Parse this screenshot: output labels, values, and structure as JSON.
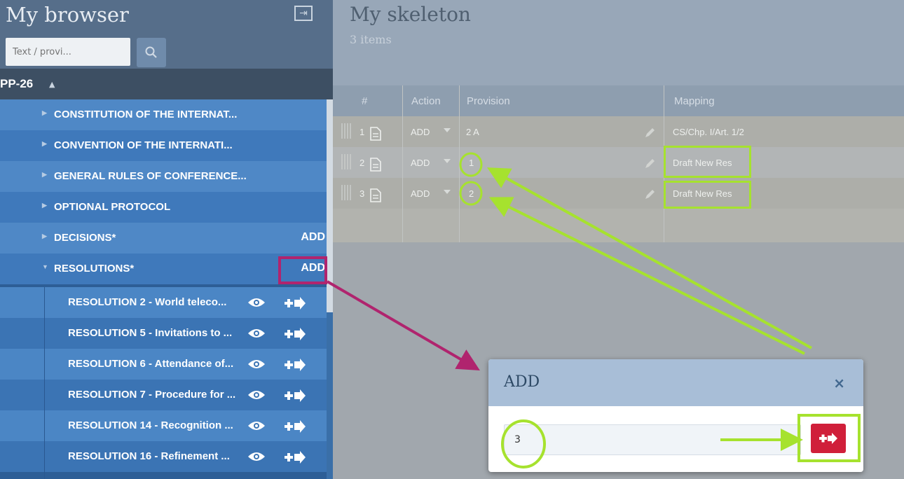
{
  "sidebar": {
    "title": "My browser",
    "search_placeholder": "Text / provi...",
    "pp_label": "PP-26",
    "items": [
      {
        "label": "CONSTITUTION OF THE INTERNAT...",
        "add": ""
      },
      {
        "label": "CONVENTION OF THE INTERNATI...",
        "add": ""
      },
      {
        "label": "GENERAL RULES OF CONFERENCE...",
        "add": ""
      },
      {
        "label": "OPTIONAL PROTOCOL",
        "add": ""
      },
      {
        "label": "DECISIONS*",
        "add": "ADD"
      },
      {
        "label": "RESOLUTIONS*",
        "add": "ADD"
      }
    ],
    "sub_items": [
      {
        "label": "RESOLUTION 2 - World teleco..."
      },
      {
        "label": "RESOLUTION 5 - Invitations to ..."
      },
      {
        "label": "RESOLUTION 6 - Attendance of..."
      },
      {
        "label": "RESOLUTION 7 - Procedure for ..."
      },
      {
        "label": "RESOLUTION 14 - Recognition ..."
      },
      {
        "label": "RESOLUTION 16 - Refinement ..."
      }
    ]
  },
  "main": {
    "title": "My skeleton",
    "subtitle": "3 items",
    "columns": [
      "#",
      "Action",
      "Provision",
      "Mapping"
    ],
    "rows": [
      {
        "num": "1",
        "action": "ADD",
        "provision": "2 A",
        "mapping": "CS/Chp. I/Art. 1/2"
      },
      {
        "num": "2",
        "action": "ADD",
        "provision": "1",
        "mapping": "Draft New Res"
      },
      {
        "num": "3",
        "action": "ADD",
        "provision": "2",
        "mapping": "Draft New Res"
      }
    ]
  },
  "modal": {
    "title": "ADD",
    "close": "×",
    "input_value": "3"
  },
  "colors": {
    "highlight_green": "#a6e22e",
    "highlight_magenta": "#b0246e",
    "submit_red": "#d01f3a"
  }
}
